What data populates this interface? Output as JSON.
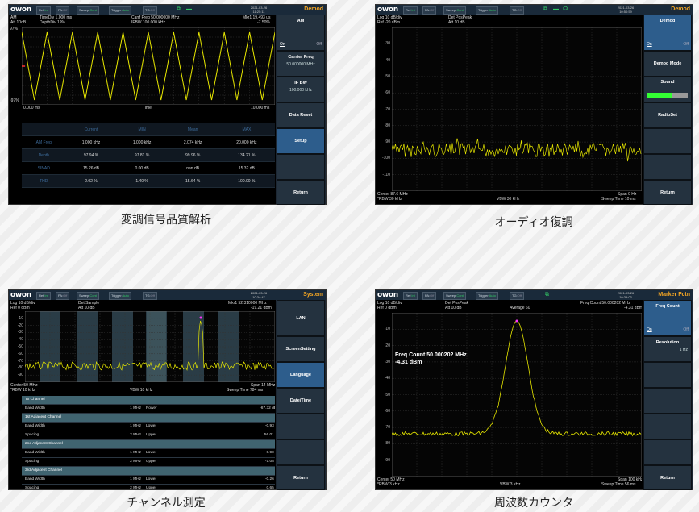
{
  "brand": "owon",
  "captions": [
    "変調信号品質解析",
    "オーディオ復調",
    "チャンネル測定",
    "周波数カウンタ"
  ],
  "top": {
    "ref_label": "Ref:",
    "ref_val": "Int",
    "pa_label": "PA:",
    "pa_val": "Off",
    "sweep_label": "Sweep:",
    "sweep_val": "Cont",
    "trigger_label": "Trigger:",
    "trigger_val": "Auto",
    "tg_label": "TG:",
    "tg_val": "Off"
  },
  "p1": {
    "date": "2021-03-26",
    "time": "11:25:11",
    "mode": "Demod",
    "info": [
      "AM",
      "TimeDiv 1.000 ms",
      "Carrf Freq 50.000000 MHz",
      "Mkr1 19.493 us",
      "Att 10dB",
      "DepthDiv 19%",
      "IFBW 100.000 kHz",
      "-7.50%"
    ],
    "y_top": "97%",
    "y_bot": "-97%",
    "x_left": "0.000 ms",
    "x_mid": "Time",
    "x_right": "10.000 ms",
    "table_headers": [
      "",
      "Current",
      "MIN",
      "Mean",
      "MAX"
    ],
    "table_rows": [
      [
        "AM Freq",
        "1.000 kHz",
        "1.000 kHz",
        "2.074 kHz",
        "20.000 kHz"
      ],
      [
        "Depth",
        "97.94 %",
        "97.81 %",
        "99.96 %",
        "134.21 %"
      ],
      [
        "SINAD",
        "15.26 dB",
        "0.00 dB",
        "nan dB",
        "15.32 dB"
      ],
      [
        "THD",
        "2.02 %",
        "1.40 %",
        "15.64 %",
        "100.00 %"
      ]
    ],
    "side": {
      "am_title": "AM",
      "on": "On",
      "off": "Off",
      "carrier_title": "Carrier Freq",
      "carrier_val": "50.000000 MHz",
      "ifbw_title": "IF BW",
      "ifbw_val": "100.000 kHz",
      "data_reset": "Data Reset",
      "setup": "Setup",
      "return": "Return"
    }
  },
  "p2": {
    "date": "2021-03-26",
    "time": "10:50:59",
    "mode": "Demod",
    "info": [
      "Log 10 dB/div",
      "Det PosPeak",
      "Ref -20 dBm",
      "Att 10 dB"
    ],
    "ylabels": [
      "-30",
      "-40",
      "-50",
      "-60",
      "-70",
      "-80",
      "-90",
      "-100",
      "-110"
    ],
    "bottom": [
      "Center 87.6 MHz",
      "Span 0 Hz",
      "*RBW 30 kHz",
      "VBW 30 kHz",
      "Sweep Time 10 ms"
    ],
    "side": {
      "demod": "Demod",
      "on": "On",
      "off": "Off",
      "demod_mode": "Demod Mode",
      "sound": "Sound",
      "radio_set": "RadioSet",
      "return": "Return"
    },
    "sound_level": 0.6
  },
  "p3": {
    "date": "2021-03-26",
    "time": "10:34:47",
    "mode": "System",
    "info": [
      "Log 10 dB/div",
      "Det Sample",
      "Mkr1 52.310000 MHz",
      "Ref 0 dBm",
      "Att 10 dB",
      "-19.21 dBm"
    ],
    "ylabels": [
      "-10",
      "-20",
      "-30",
      "-40",
      "-50",
      "-60",
      "-70",
      "-80",
      "-90"
    ],
    "bottom": [
      "Center 50 MHz",
      "Span 14 MHz",
      "*RBW 10 kHz",
      "VBW 10 kHz",
      "Sweep Time 784 ms"
    ],
    "channels": [
      {
        "name": "Tx Channel",
        "rows": [
          [
            "Band Width",
            "1 MHz",
            "Power",
            "-67.32 dBm"
          ]
        ]
      },
      {
        "name": "1st Adjacent Channel",
        "rows": [
          [
            "Band Width",
            "1 MHz",
            "Lower",
            "-0.93 dB"
          ],
          [
            "Spacing",
            "2 MHz",
            "Upper",
            "56.01 dB"
          ]
        ]
      },
      {
        "name": "2nd Adjacent Channel",
        "rows": [
          [
            "Band Width",
            "1 MHz",
            "Lower",
            "-0.90 dB"
          ],
          [
            "Spacing",
            "2 MHz",
            "Upper",
            "-1.05 dB"
          ]
        ]
      },
      {
        "name": "3rd Adjacent Channel",
        "rows": [
          [
            "Band Width",
            "1 MHz",
            "Lower",
            "-0.26 dB"
          ],
          [
            "Spacing",
            "2 MHz",
            "Upper",
            "0.65 dB"
          ]
        ]
      }
    ],
    "side": {
      "lan": "LAN",
      "screen": "ScreenSetting",
      "language": "Language",
      "datetime": "Date/Time",
      "return": "Return"
    }
  },
  "p4": {
    "date": "2021-03-26",
    "time": "10:39:03",
    "mode": "Marker Fctn",
    "info": [
      "Log 10 dB/div",
      "Det PosPeak",
      "Freq Count 50.000202 MHz",
      "Ref 0 dBm",
      "Att 10 dB",
      "Average 60",
      "-4.31 dBm"
    ],
    "count_label": "Freq Count  50.000202 MHz",
    "count_val": "-4.31 dBm",
    "ylabels": [
      "-10",
      "-20",
      "-30",
      "-40",
      "-50",
      "-60",
      "-70",
      "-80",
      "-90"
    ],
    "bottom": [
      "Center 50 MHz",
      "Span 100 kHz",
      "*RBW 3 kHz",
      "VBW 3 kHz",
      "Sweep Time 56 ms"
    ],
    "side": {
      "freq_count": "Freq Count",
      "on": "On",
      "off": "Off",
      "resolution": "Resolution",
      "res_val": "1 Hz",
      "return": "Return"
    }
  }
}
